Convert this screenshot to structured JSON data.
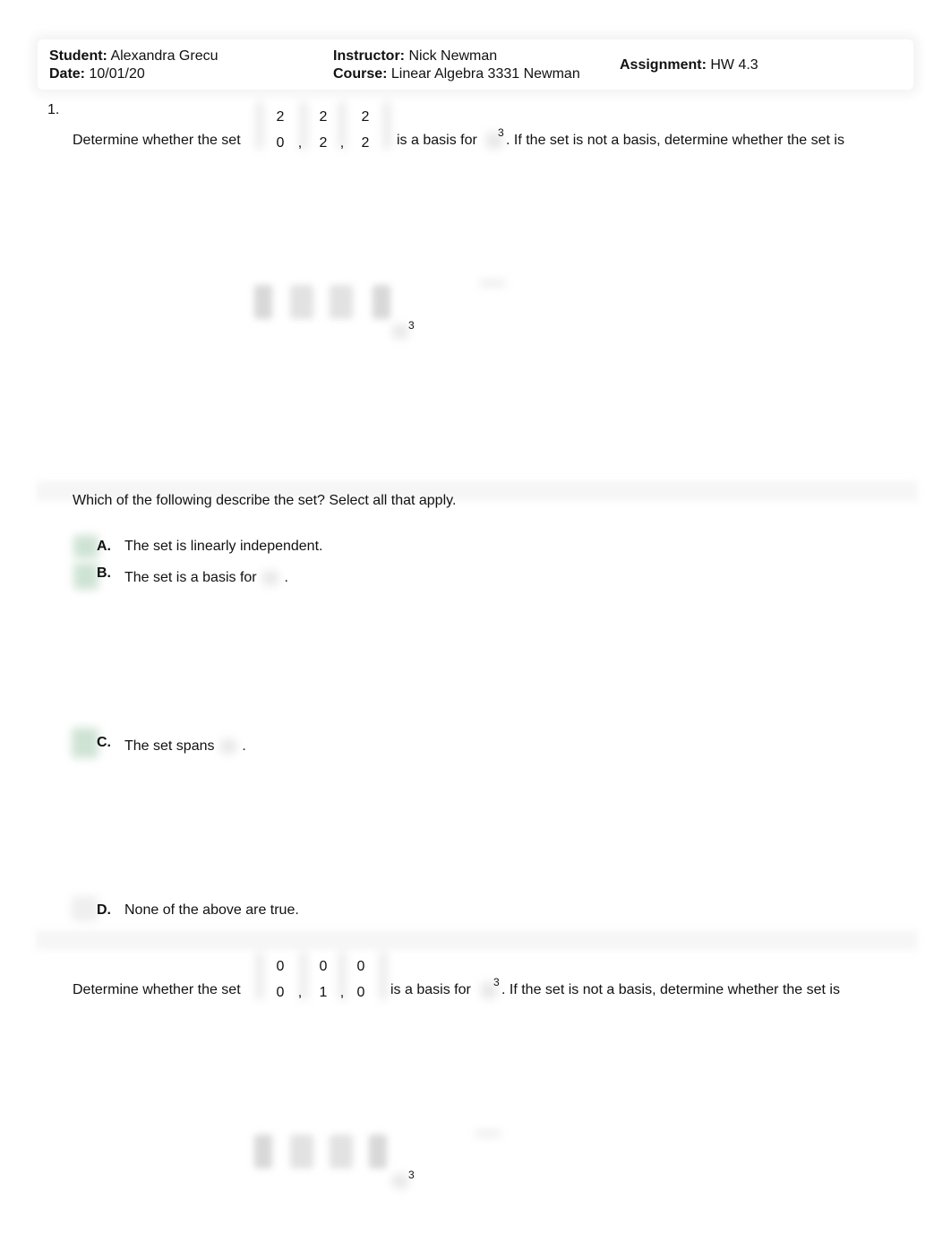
{
  "header": {
    "student_label": "Student:",
    "student_value": "Alexandra Grecu",
    "date_label": "Date:",
    "date_value": "10/01/20",
    "instructor_label": "Instructor:",
    "instructor_value": "Nick Newman",
    "course_label": "Course:",
    "course_value": "Linear Algebra 3331 Newman",
    "assignment_label": "Assignment:",
    "assignment_value": "HW 4.3"
  },
  "question1": {
    "number": "1.",
    "prompt_before": "Determine whether the set",
    "prompt_after_set": "is a basis for",
    "superscript": "3",
    "prompt_tail": ". If the set is not a basis, determine whether the set is",
    "vectors": [
      {
        "top": "2",
        "bottom": "0"
      },
      {
        "top": "2",
        "bottom": "2"
      },
      {
        "top": "2",
        "bottom": "2"
      }
    ],
    "separator": ",",
    "work_superscript": "3",
    "instruction": "Which of the following describe the set? Select all that apply.",
    "options": [
      {
        "letter": "A.",
        "text": "The set is linearly independent.",
        "selected": true
      },
      {
        "letter": "B.",
        "text": "The set is a basis for",
        "suffix": ".",
        "selected": true
      },
      {
        "letter": "C.",
        "text": "The set spans",
        "suffix": ".",
        "selected": true
      },
      {
        "letter": "D.",
        "text": "None of the above are true.",
        "selected": false
      }
    ]
  },
  "question2": {
    "prompt_before": "Determine whether the set",
    "prompt_after_set": "is a basis for",
    "superscript": "3",
    "prompt_tail": ". If the set is not a basis, determine whether the set is",
    "vectors": [
      {
        "top": "0",
        "bottom": "0"
      },
      {
        "top": "0",
        "bottom": "1"
      },
      {
        "top": "0",
        "bottom": "0"
      }
    ],
    "separator": ",",
    "work_superscript": "3"
  },
  "colors": {
    "selected_indicator": "#cfe3d4",
    "text": "#111111"
  }
}
